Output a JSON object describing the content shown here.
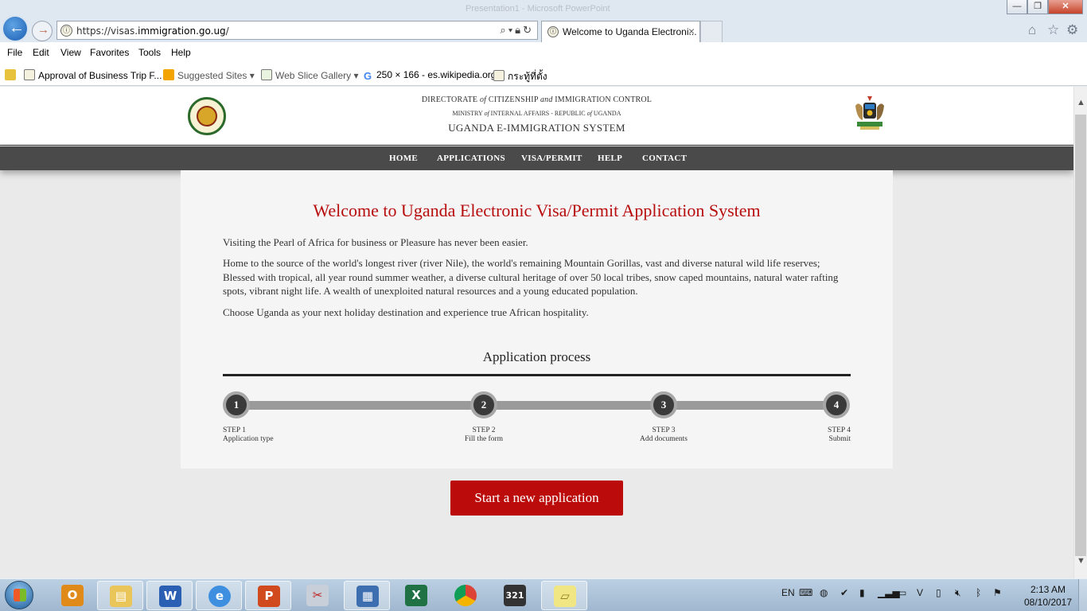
{
  "browser": {
    "window_title": "Presentation1 - Microsoft PowerPoint",
    "url_prefix": "https://visas.",
    "url_domain": "immigration.go.ug",
    "url_suffix": "/",
    "tab_title": "Welcome to Uganda Electroni...",
    "window_buttons": {
      "minimize": "—",
      "maximize": "❐",
      "close": "✕"
    }
  },
  "menu": [
    "File",
    "Edit",
    "View",
    "Favorites",
    "Tools",
    "Help"
  ],
  "favorites": [
    {
      "label": "Approval of Business Trip F..."
    },
    {
      "label": "Suggested Sites ▾"
    },
    {
      "label": "Web Slice Gallery ▾"
    },
    {
      "label": "250 × 166 - es.wikipedia.org"
    },
    {
      "label": "กระทู้ที่ตั้ง"
    }
  ],
  "header": {
    "line1_a": "DIRECTORATE",
    "line1_of": "of",
    "line1_b": "CITIZENSHIP",
    "line1_and": "and",
    "line1_c": "IMMIGRATION CONTROL",
    "line2_a": "MINISTRY",
    "line2_of": "of",
    "line2_b": "INTERNAL AFFAIRS - REPUBLIC",
    "line2_of2": "of",
    "line2_c": "UGANDA",
    "line3": "UGANDA E-IMMIGRATION SYSTEM"
  },
  "nav": [
    "HOME",
    "APPLICATIONS",
    "VISA/PERMIT",
    "HELP",
    "CONTACT"
  ],
  "main": {
    "title": "Welcome to Uganda Electronic Visa/Permit Application System",
    "p1": "Visiting the Pearl of Africa for business or Pleasure has never been easier.",
    "p2": "Home to the source of the world's longest river (river Nile), the world's remaining Mountain Gorillas, vast and diverse natural wild life reserves; Blessed with tropical, all year round summer weather, a diverse cultural heritage of over 50 local tribes, snow caped mountains, natural water rafting spots, vibrant night life. A wealth of unexploited natural resources and a young educated population.",
    "p3": "Choose Uganda as your next holiday destination and experience true African hospitality.",
    "process_title": "Application process",
    "steps": [
      {
        "num": "1",
        "step": "STEP 1",
        "label": "Application type"
      },
      {
        "num": "2",
        "step": "STEP 2",
        "label": "Fill the form"
      },
      {
        "num": "3",
        "step": "STEP 3",
        "label": "Add documents"
      },
      {
        "num": "4",
        "step": "STEP 4",
        "label": "Submit"
      }
    ],
    "start_button": "Start a new application"
  },
  "taskbar": {
    "lang": "EN",
    "time": "2:13 AM",
    "date": "08/10/2017"
  }
}
